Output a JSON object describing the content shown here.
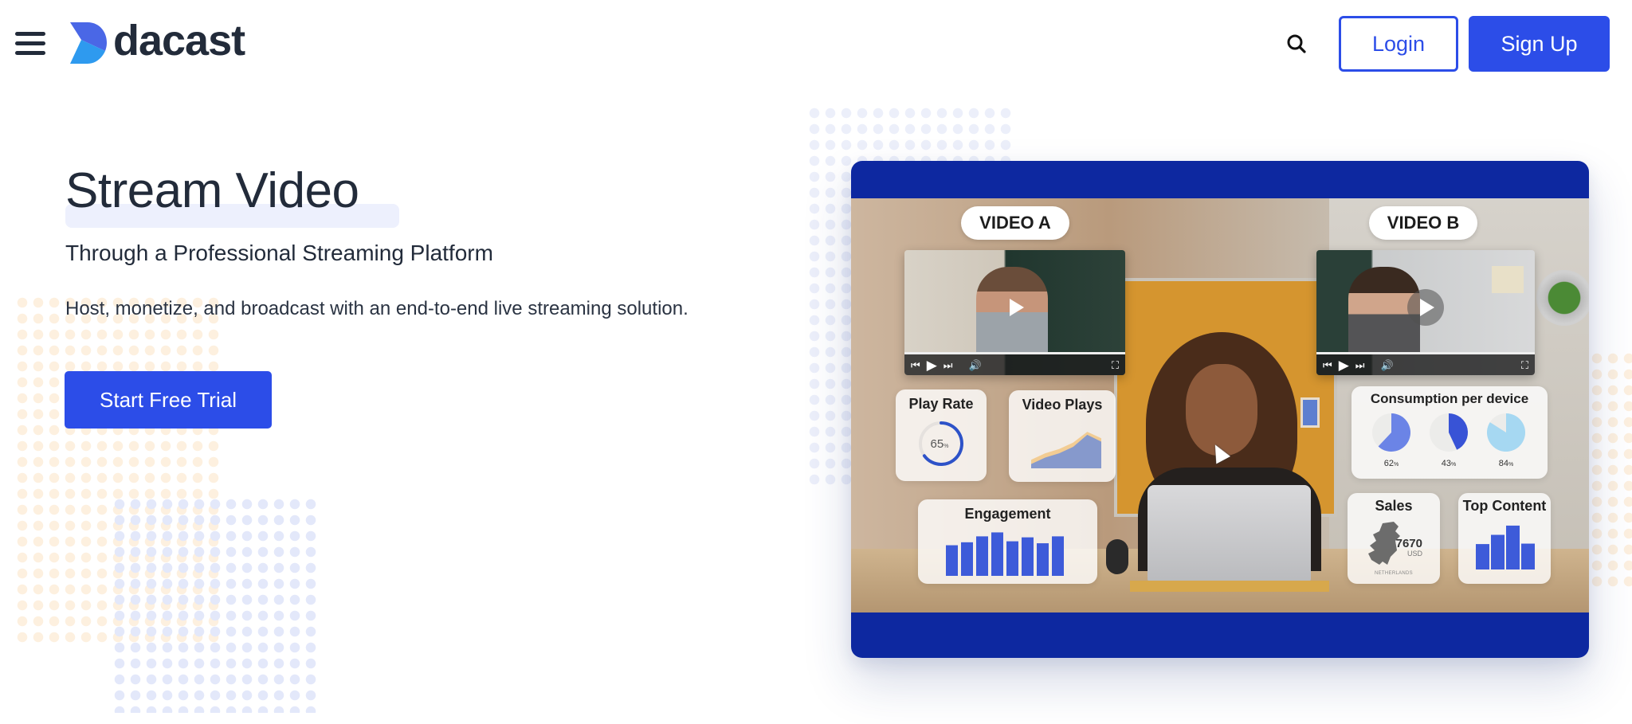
{
  "header": {
    "brand": "dacast",
    "login_label": "Login",
    "signup_label": "Sign Up",
    "icons": {
      "menu": "hamburger-menu-icon",
      "search": "search-icon"
    }
  },
  "hero": {
    "title": "Stream Video",
    "subtitle": "Through a Professional Streaming Platform",
    "description": "Host, monetize, and broadcast with an end-to-end live streaming solution.",
    "cta_label": "Start Free Trial"
  },
  "colors": {
    "brand_blue": "#2c4de8",
    "panel_blue": "#0d28a0",
    "text_dark": "#222b3a",
    "chart_blue": "#3d5bd9",
    "chart_orange": "#f2c98a"
  },
  "video_panel": {
    "video_a_label": "VIDEO A",
    "video_b_label": "VIDEO B",
    "player_controls": [
      "previous",
      "play",
      "next",
      "volume",
      "fullscreen"
    ],
    "cards": {
      "play_rate": {
        "title": "Play Rate",
        "value": 65,
        "unit": "%",
        "display": "65"
      },
      "video_plays": {
        "title": "Video Plays",
        "series_back": [
          20,
          35,
          45,
          60,
          85,
          70
        ],
        "series_front": [
          10,
          25,
          35,
          50,
          78,
          62
        ]
      },
      "engagement": {
        "title": "Engagement",
        "values": [
          62,
          68,
          80,
          88,
          70,
          78,
          66,
          80
        ]
      },
      "consumption": {
        "title": "Consumption per device",
        "items": [
          {
            "value": 62,
            "label": "62",
            "color": "#6b84e6"
          },
          {
            "value": 43,
            "label": "43",
            "color": "#3853d6"
          },
          {
            "value": 84,
            "label": "84",
            "color": "#a6d8f2"
          }
        ],
        "unit": "%"
      },
      "sales": {
        "title": "Sales",
        "value": "7670",
        "currency": "USD",
        "country": "NETHERLANDS"
      },
      "top_content": {
        "title": "Top Content",
        "values": [
          55,
          75,
          95,
          56
        ]
      }
    }
  }
}
